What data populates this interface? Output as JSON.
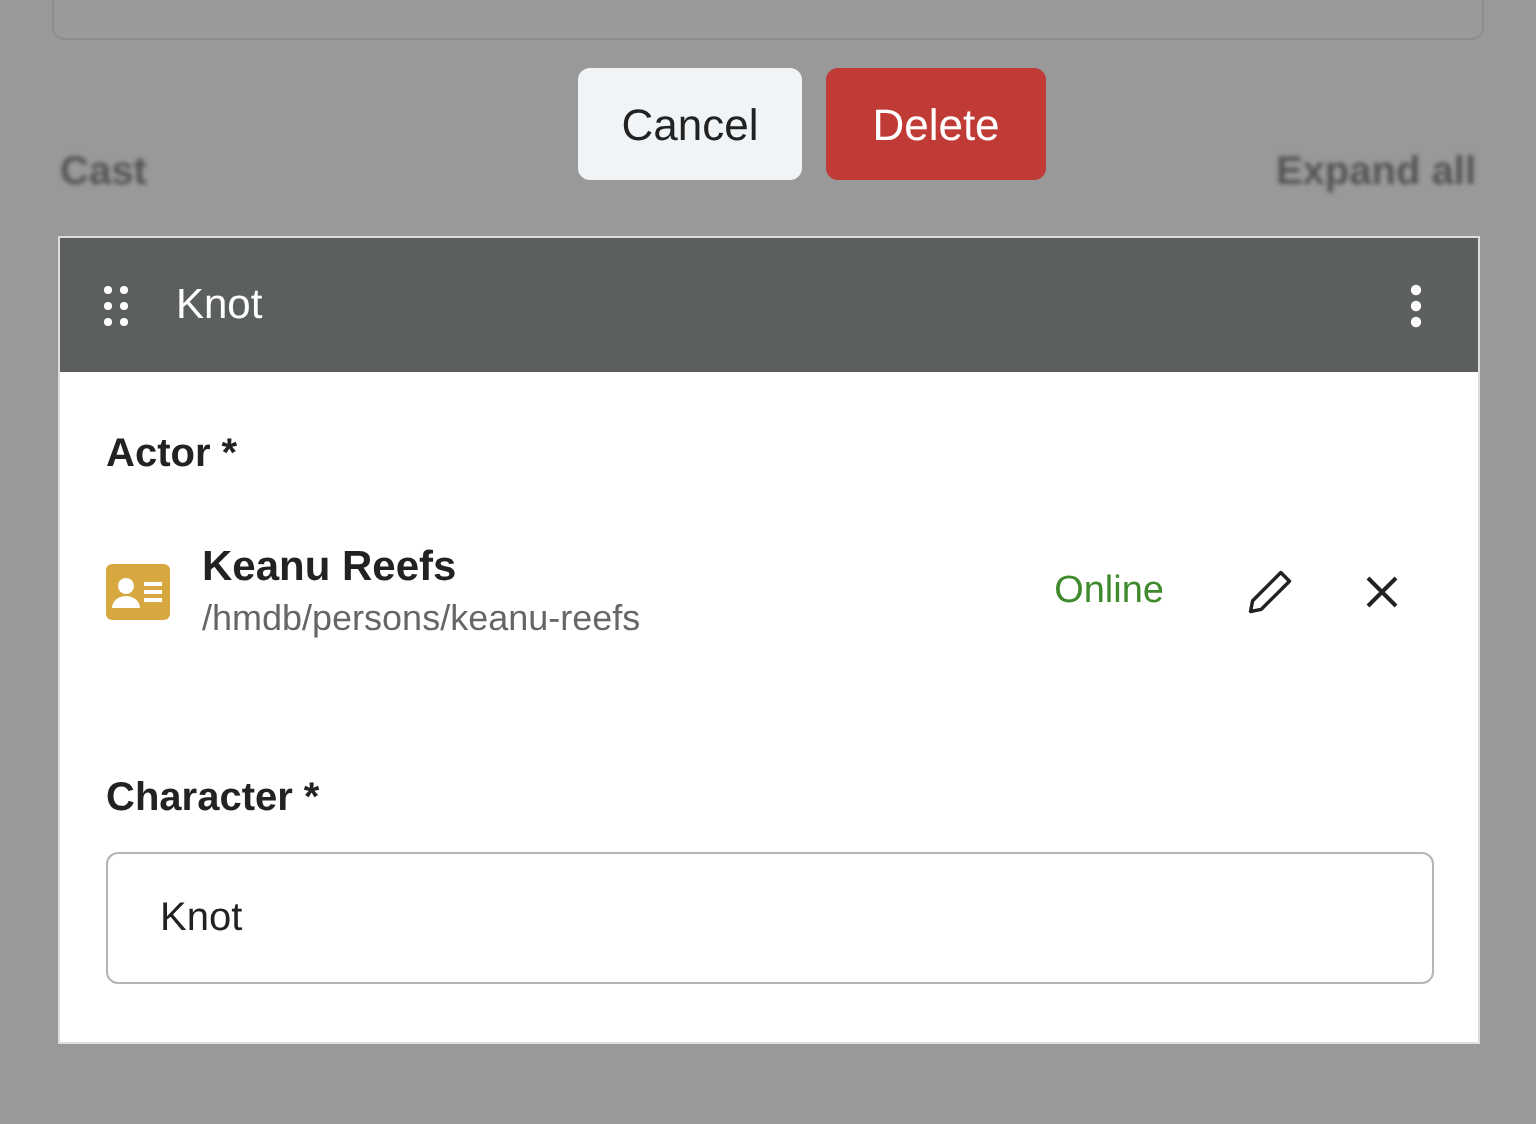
{
  "actions": {
    "cancel": "Cancel",
    "delete": "Delete"
  },
  "section": {
    "title": "Cast",
    "expand": "Expand all"
  },
  "card": {
    "title": "Knot",
    "actor": {
      "label": "Actor *",
      "name": "Keanu Reefs",
      "path": "/hmdb/persons/keanu-reefs",
      "status": "Online"
    },
    "character": {
      "label": "Character *",
      "value": "Knot"
    }
  }
}
